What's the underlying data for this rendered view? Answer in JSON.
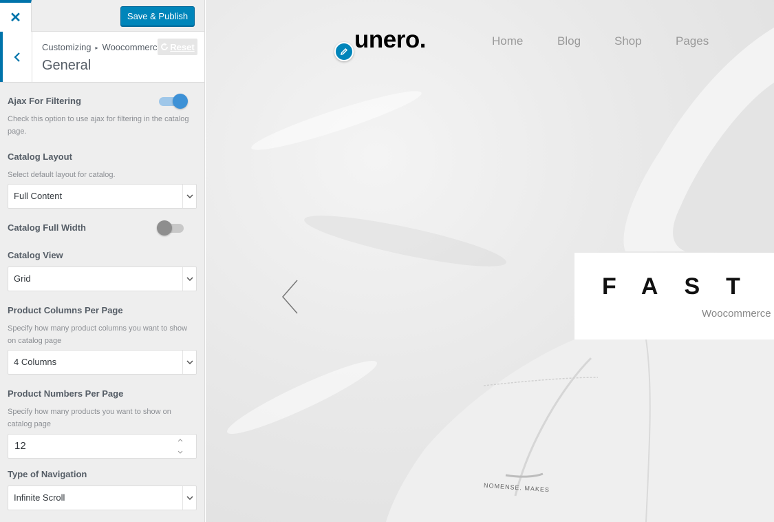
{
  "customizer": {
    "close_icon": "close-icon",
    "publish_label": "Save & Publish",
    "breadcrumb": [
      "Customizing",
      "Woocommerce"
    ],
    "section_title": "General",
    "reset_label": "Reset",
    "accent_color": "#0073aa",
    "controls": {
      "ajax": {
        "label": "Ajax For Filtering",
        "desc": "Check this option to use ajax for filtering in the catalog page.",
        "enabled": true
      },
      "catalog_layout": {
        "label": "Catalog Layout",
        "desc": "Select default layout for catalog.",
        "value": "Full Content"
      },
      "full_width": {
        "label": "Catalog Full Width",
        "enabled": false
      },
      "catalog_view": {
        "label": "Catalog View",
        "value": "Grid"
      },
      "columns": {
        "label": "Product Columns Per Page",
        "desc": "Specify how many product columns you want to show on catalog page",
        "value": "4 Columns"
      },
      "numbers": {
        "label": "Product Numbers Per Page",
        "desc": "Specify how many products you want to show on catalog page",
        "value": "12"
      },
      "navigation": {
        "label": "Type of Navigation",
        "value": "Infinite Scroll"
      }
    }
  },
  "preview": {
    "logo": "unero.",
    "nav": [
      "Home",
      "Blog",
      "Shop",
      "Pages"
    ],
    "hero_title": "FAST",
    "hero_subtitle": "Woocommerce",
    "garment_tag": "NOMENSE. MAKES"
  }
}
